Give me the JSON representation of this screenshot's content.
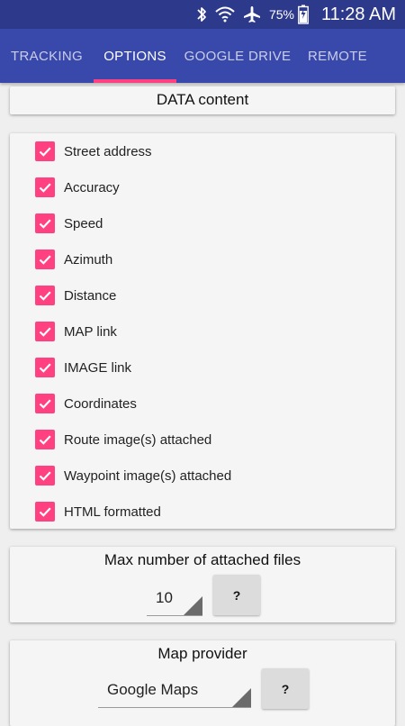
{
  "status_bar": {
    "battery_percent": "75%",
    "time": "11:28 AM",
    "icons": [
      "bluetooth-icon",
      "wifi-icon",
      "airplane-mode-icon",
      "battery-charging-icon"
    ]
  },
  "tabs": [
    {
      "label": "TRACKING",
      "active": false
    },
    {
      "label": "OPTIONS",
      "active": true
    },
    {
      "label": "GOOGLE DRIVE",
      "active": false
    },
    {
      "label": "REMOTE",
      "active": false
    }
  ],
  "data_content": {
    "title": "DATA content",
    "options": [
      {
        "label": "Street address",
        "checked": true
      },
      {
        "label": "Accuracy",
        "checked": true
      },
      {
        "label": "Speed",
        "checked": true
      },
      {
        "label": "Azimuth",
        "checked": true
      },
      {
        "label": "Distance",
        "checked": true
      },
      {
        "label": "MAP link",
        "checked": true
      },
      {
        "label": "IMAGE link",
        "checked": true
      },
      {
        "label": "Coordinates",
        "checked": true
      },
      {
        "label": "Route image(s) attached",
        "checked": true
      },
      {
        "label": "Waypoint image(s) attached",
        "checked": true
      },
      {
        "label": "HTML formatted",
        "checked": true
      }
    ]
  },
  "max_files": {
    "title": "Max number of attached files",
    "value": "10",
    "help_label": "?"
  },
  "map_provider": {
    "title": "Map provider",
    "value": "Google Maps",
    "help_label": "?"
  },
  "colors": {
    "status_bar": "#2d3a8c",
    "app_bar": "#3949ab",
    "accent": "#ff4081",
    "card": "#f5f5f5"
  }
}
